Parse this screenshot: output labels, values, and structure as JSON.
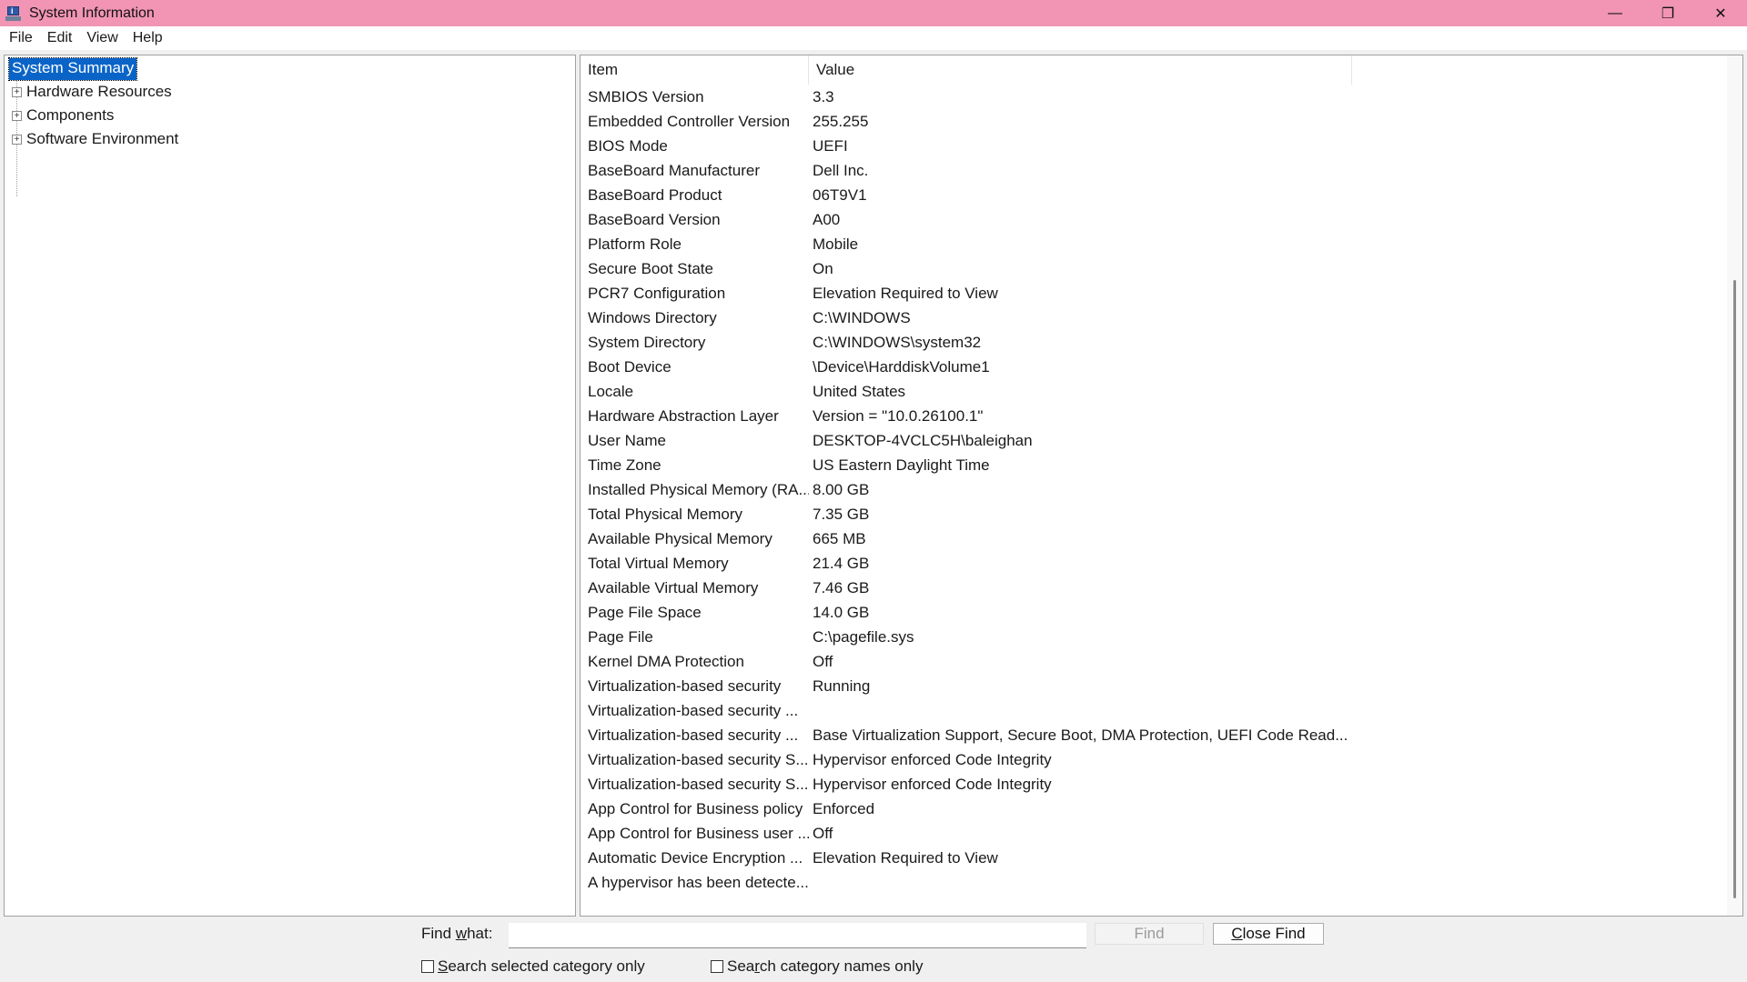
{
  "window": {
    "title": "System Information",
    "controls": {
      "minimize": "—",
      "restore": "❐",
      "close": "✕"
    }
  },
  "menu": [
    "File",
    "Edit",
    "View",
    "Help"
  ],
  "tree": {
    "root": "System Summary",
    "expander_symbol": "+",
    "nodes": [
      "Hardware Resources",
      "Components",
      "Software Environment"
    ]
  },
  "list": {
    "headers": {
      "item": "Item",
      "value": "Value"
    },
    "rows": [
      {
        "item": "SMBIOS Version",
        "value": "3.3"
      },
      {
        "item": "Embedded Controller Version",
        "value": "255.255"
      },
      {
        "item": "BIOS Mode",
        "value": "UEFI"
      },
      {
        "item": "BaseBoard Manufacturer",
        "value": "Dell Inc."
      },
      {
        "item": "BaseBoard Product",
        "value": "06T9V1"
      },
      {
        "item": "BaseBoard Version",
        "value": "A00"
      },
      {
        "item": "Platform Role",
        "value": "Mobile"
      },
      {
        "item": "Secure Boot State",
        "value": "On"
      },
      {
        "item": "PCR7 Configuration",
        "value": "Elevation Required to View"
      },
      {
        "item": "Windows Directory",
        "value": "C:\\WINDOWS"
      },
      {
        "item": "System Directory",
        "value": "C:\\WINDOWS\\system32"
      },
      {
        "item": "Boot Device",
        "value": "\\Device\\HarddiskVolume1"
      },
      {
        "item": "Locale",
        "value": "United States"
      },
      {
        "item": "Hardware Abstraction Layer",
        "value": "Version = \"10.0.26100.1\""
      },
      {
        "item": "User Name",
        "value": "DESKTOP-4VCLC5H\\baleighan"
      },
      {
        "item": "Time Zone",
        "value": "US Eastern Daylight Time"
      },
      {
        "item": "Installed Physical Memory (RA...",
        "value": "8.00 GB"
      },
      {
        "item": "Total Physical Memory",
        "value": "7.35 GB"
      },
      {
        "item": "Available Physical Memory",
        "value": "665 MB"
      },
      {
        "item": "Total Virtual Memory",
        "value": "21.4 GB"
      },
      {
        "item": "Available Virtual Memory",
        "value": "7.46 GB"
      },
      {
        "item": "Page File Space",
        "value": "14.0 GB"
      },
      {
        "item": "Page File",
        "value": "C:\\pagefile.sys"
      },
      {
        "item": "Kernel DMA Protection",
        "value": "Off"
      },
      {
        "item": "Virtualization-based security",
        "value": "Running"
      },
      {
        "item": "Virtualization-based security ...",
        "value": ""
      },
      {
        "item": "Virtualization-based security ...",
        "value": "Base Virtualization Support, Secure Boot, DMA Protection, UEFI Code Read..."
      },
      {
        "item": "Virtualization-based security S...",
        "value": "Hypervisor enforced Code Integrity"
      },
      {
        "item": "Virtualization-based security S...",
        "value": "Hypervisor enforced Code Integrity"
      },
      {
        "item": "App Control for Business policy",
        "value": "Enforced"
      },
      {
        "item": "App Control for Business user ...",
        "value": "Off"
      },
      {
        "item": "Automatic Device Encryption ...",
        "value": "Elevation Required to View"
      },
      {
        "item": "A hypervisor has been detecte...",
        "value": ""
      }
    ]
  },
  "find": {
    "label_pre": "Find ",
    "label_key": "w",
    "label_post": "hat:",
    "input_value": "",
    "find_button": "Find",
    "close_find_pre": "",
    "close_find_key": "C",
    "close_find_post": "lose Find",
    "selected_only_pre": "",
    "selected_only_key": "S",
    "selected_only_post": "earch selected category only",
    "names_only_pre": "Sea",
    "names_only_key": "r",
    "names_only_post": "ch category names only"
  },
  "colors": {
    "titlebar": "#f295b4",
    "selection": "#0a64c8"
  }
}
